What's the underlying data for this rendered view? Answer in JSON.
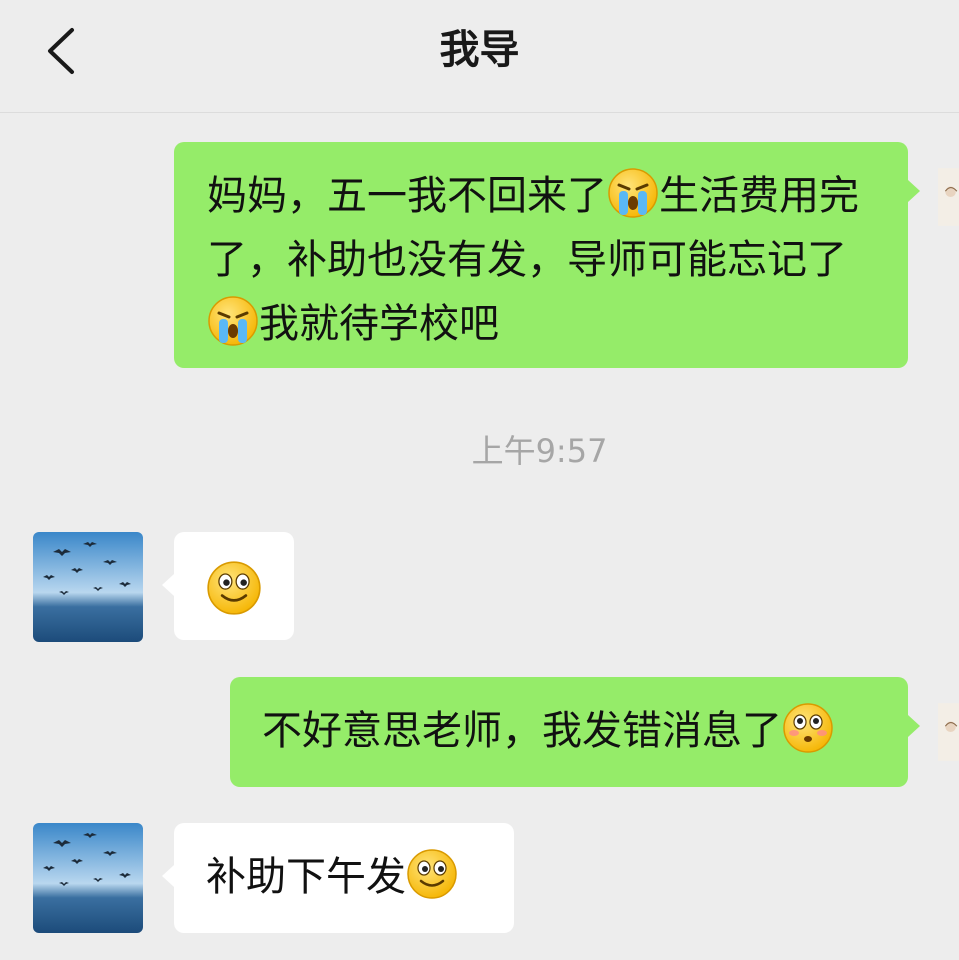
{
  "header": {
    "title": "我导"
  },
  "messages": [
    {
      "side": "right",
      "segments": [
        "妈妈，五一我不回来了",
        "生活费用完了，补助也没有发，导师可能忘记了",
        "我就待学校吧"
      ],
      "emojis": [
        "crying-face",
        "crying-face"
      ]
    },
    {
      "side": "left",
      "emojis": [
        "smile-face"
      ]
    },
    {
      "side": "right",
      "segments": [
        "不好意思老师，我发错消息了"
      ],
      "emojis": [
        "flushed-face"
      ]
    },
    {
      "side": "left",
      "segments": [
        "补助下午发"
      ],
      "emojis": [
        "smile-face"
      ]
    }
  ],
  "timestamp": "上午9:57",
  "colors": {
    "background": "#ededed",
    "sent_bubble": "#95ec69",
    "received_bubble": "#ffffff",
    "timestamp_text": "#a6a6a6"
  }
}
